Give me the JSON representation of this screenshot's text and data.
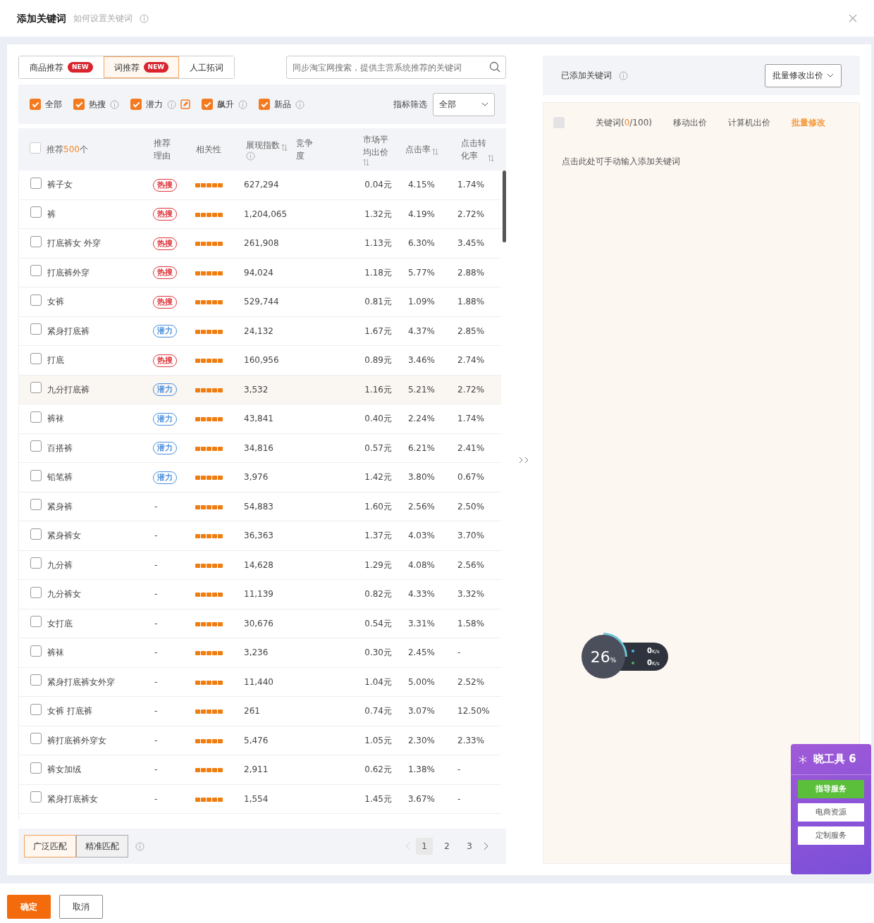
{
  "dialog": {
    "title": "添加关键词",
    "subtitle": "如何设置关键词"
  },
  "tabs": [
    {
      "label": "商品推荐",
      "badge": "NEW",
      "selected": false
    },
    {
      "label": "词推荐",
      "badge": "NEW",
      "selected": true
    },
    {
      "label": "人工拓词",
      "selected": false
    }
  ],
  "search": {
    "placeholder": "同步淘宝网搜索，提供主营系统推荐的关键词"
  },
  "filters": [
    {
      "label": "全部",
      "checked": true,
      "info": false
    },
    {
      "label": "热搜",
      "checked": true,
      "info": true
    },
    {
      "label": "潜力",
      "checked": true,
      "info": true,
      "edit": true
    },
    {
      "label": "飙升",
      "checked": true,
      "info": true
    },
    {
      "label": "新品",
      "checked": true,
      "info": true
    }
  ],
  "filter_select": {
    "label": "指标筛选",
    "value": "全部"
  },
  "table": {
    "select_all_checked": false,
    "head": {
      "label": "推荐",
      "count": "500",
      "unit": "个"
    },
    "columns": [
      {
        "label": "推荐理由",
        "sortable": false,
        "info": false
      },
      {
        "label": "相关性",
        "sortable": false,
        "info": false
      },
      {
        "label": "展现指数",
        "sortable": true,
        "info": true
      },
      {
        "label": "竞争度",
        "sortable": false,
        "info": false
      },
      {
        "label": "市场平均出价",
        "sortable": true,
        "info": false
      },
      {
        "label": "点击率",
        "sortable": true,
        "info": false
      },
      {
        "label": "点击转化率",
        "sortable": true,
        "info": false
      }
    ],
    "rows": [
      {
        "keyword": "裤子女",
        "reason": {
          "text": "热搜",
          "color": "#e0373d"
        },
        "stars": 5,
        "impressions": "627,294",
        "avg_bid": "0.04元",
        "ctr": "4.15%",
        "cvr": "1.74%",
        "checked": false,
        "hovered": false
      },
      {
        "keyword": "裤",
        "reason": {
          "text": "热搜",
          "color": "#e0373d"
        },
        "stars": 5,
        "impressions": "1,204,065",
        "avg_bid": "1.32元",
        "ctr": "4.19%",
        "cvr": "2.72%",
        "checked": false,
        "hovered": false
      },
      {
        "keyword": "打底裤女 外穿",
        "reason": {
          "text": "热搜",
          "color": "#e0373d"
        },
        "stars": 5,
        "impressions": "261,908",
        "avg_bid": "1.13元",
        "ctr": "6.30%",
        "cvr": "3.45%",
        "checked": false,
        "hovered": false
      },
      {
        "keyword": "打底裤外穿",
        "reason": {
          "text": "热搜",
          "color": "#e0373d"
        },
        "stars": 5,
        "impressions": "94,024",
        "avg_bid": "1.18元",
        "ctr": "5.77%",
        "cvr": "2.88%",
        "checked": false,
        "hovered": false
      },
      {
        "keyword": "女裤",
        "reason": {
          "text": "热搜",
          "color": "#e0373d"
        },
        "stars": 5,
        "impressions": "529,744",
        "avg_bid": "0.81元",
        "ctr": "1.09%",
        "cvr": "1.88%",
        "checked": false,
        "hovered": false
      },
      {
        "keyword": "紧身打底裤",
        "reason": {
          "text": "潜力",
          "color": "#4a8ee0"
        },
        "stars": 5,
        "impressions": "24,132",
        "avg_bid": "1.67元",
        "ctr": "4.37%",
        "cvr": "2.85%",
        "checked": false,
        "hovered": false
      },
      {
        "keyword": "打底",
        "reason": {
          "text": "热搜",
          "color": "#e0373d"
        },
        "stars": 5,
        "impressions": "160,956",
        "avg_bid": "0.89元",
        "ctr": "3.46%",
        "cvr": "2.74%",
        "checked": false,
        "hovered": false
      },
      {
        "keyword": "九分打底裤",
        "reason": {
          "text": "潜力",
          "color": "#4a8ee0"
        },
        "stars": 5,
        "impressions": "3,532",
        "avg_bid": "1.16元",
        "ctr": "5.21%",
        "cvr": "2.72%",
        "checked": false,
        "hovered": true
      },
      {
        "keyword": "裤袜",
        "reason": {
          "text": "潜力",
          "color": "#4a8ee0"
        },
        "stars": 5,
        "impressions": "43,841",
        "avg_bid": "0.40元",
        "ctr": "2.24%",
        "cvr": "1.74%",
        "checked": false,
        "hovered": false
      },
      {
        "keyword": "百搭裤",
        "reason": {
          "text": "潜力",
          "color": "#4a8ee0"
        },
        "stars": 5,
        "impressions": "34,816",
        "avg_bid": "0.57元",
        "ctr": "6.21%",
        "cvr": "2.41%",
        "checked": false,
        "hovered": false
      },
      {
        "keyword": "铅笔裤",
        "reason": {
          "text": "潜力",
          "color": "#4a8ee0"
        },
        "stars": 5,
        "impressions": "3,976",
        "avg_bid": "1.42元",
        "ctr": "3.80%",
        "cvr": "0.67%",
        "checked": false,
        "hovered": false
      },
      {
        "keyword": "紧身裤",
        "reason": {
          "text": "-"
        },
        "stars": 5,
        "impressions": "54,883",
        "avg_bid": "1.60元",
        "ctr": "2.56%",
        "cvr": "2.50%",
        "checked": false,
        "hovered": false
      },
      {
        "keyword": "紧身裤女",
        "reason": {
          "text": "-"
        },
        "stars": 5,
        "impressions": "36,363",
        "avg_bid": "1.37元",
        "ctr": "4.03%",
        "cvr": "3.70%",
        "checked": false,
        "hovered": false
      },
      {
        "keyword": "九分裤",
        "reason": {
          "text": "-"
        },
        "stars": 5,
        "impressions": "14,628",
        "avg_bid": "1.29元",
        "ctr": "4.08%",
        "cvr": "2.56%",
        "checked": false,
        "hovered": false
      },
      {
        "keyword": "九分裤女",
        "reason": {
          "text": "-"
        },
        "stars": 5,
        "impressions": "11,139",
        "avg_bid": "0.82元",
        "ctr": "4.33%",
        "cvr": "3.32%",
        "checked": false,
        "hovered": false
      },
      {
        "keyword": "女打底",
        "reason": {
          "text": "-"
        },
        "stars": 5,
        "impressions": "30,676",
        "avg_bid": "0.54元",
        "ctr": "3.31%",
        "cvr": "1.58%",
        "checked": false,
        "hovered": false
      },
      {
        "keyword": "裤袜",
        "reason": {
          "text": "-"
        },
        "stars": 5,
        "impressions": "3,236",
        "avg_bid": "0.30元",
        "ctr": "2.45%",
        "cvr": "-",
        "checked": false,
        "hovered": false
      },
      {
        "keyword": "紧身打底裤女外穿",
        "reason": {
          "text": "-"
        },
        "stars": 5,
        "impressions": "11,440",
        "avg_bid": "1.04元",
        "ctr": "5.00%",
        "cvr": "2.52%",
        "checked": false,
        "hovered": false
      },
      {
        "keyword": "女裤 打底裤",
        "reason": {
          "text": "-"
        },
        "stars": 5,
        "impressions": "261",
        "avg_bid": "0.74元",
        "ctr": "3.07%",
        "cvr": "12.50%",
        "checked": false,
        "hovered": false
      },
      {
        "keyword": "裤打底裤外穿女",
        "reason": {
          "text": "-"
        },
        "stars": 5,
        "impressions": "5,476",
        "avg_bid": "1.05元",
        "ctr": "2.30%",
        "cvr": "2.33%",
        "checked": false,
        "hovered": false
      },
      {
        "keyword": "裤女加绒",
        "reason": {
          "text": "-"
        },
        "stars": 5,
        "impressions": "2,911",
        "avg_bid": "0.62元",
        "ctr": "1.38%",
        "cvr": "-",
        "checked": false,
        "hovered": false
      },
      {
        "keyword": "紧身打底裤女",
        "reason": {
          "text": "-"
        },
        "stars": 5,
        "impressions": "1,554",
        "avg_bid": "1.45元",
        "ctr": "3.67%",
        "cvr": "-",
        "checked": false,
        "hovered": false
      }
    ]
  },
  "match_types": [
    {
      "label": "广泛匹配",
      "selected": true
    },
    {
      "label": "精准匹配",
      "selected": false
    }
  ],
  "pagination": [
    {
      "label": "1",
      "selected": true
    },
    {
      "label": "2",
      "selected": false
    },
    {
      "label": "3",
      "selected": false
    }
  ],
  "added": {
    "title": "已添加关键词",
    "batch_button": "批量修改出价",
    "select_all_disabled": true,
    "keyword_column": {
      "label": "关键词(",
      "count": "0",
      "rest": "/100)"
    },
    "columns": [
      {
        "label": "移动出价",
        "kind": "plain"
      },
      {
        "label": "计算机出价",
        "kind": "plain"
      },
      {
        "label": "批量修改",
        "kind": "action"
      }
    ],
    "hint": "点击此处可手动输入添加关键词"
  },
  "speed_meter": {
    "percent": "26",
    "unit": "%",
    "upload": "0",
    "upload_unit": "K/s",
    "download": "0",
    "download_unit": "K/s"
  },
  "tool_panel": {
    "title": "晓工具 6",
    "buttons": [
      {
        "label": "指导服务",
        "kind": "primary"
      },
      {
        "label": "电商资源",
        "kind": "plain"
      },
      {
        "label": "定制服务",
        "kind": "plain"
      }
    ]
  },
  "footer_buttons": [
    {
      "label": "确定",
      "kind": "primary"
    },
    {
      "label": "取消",
      "kind": "secondary"
    }
  ]
}
